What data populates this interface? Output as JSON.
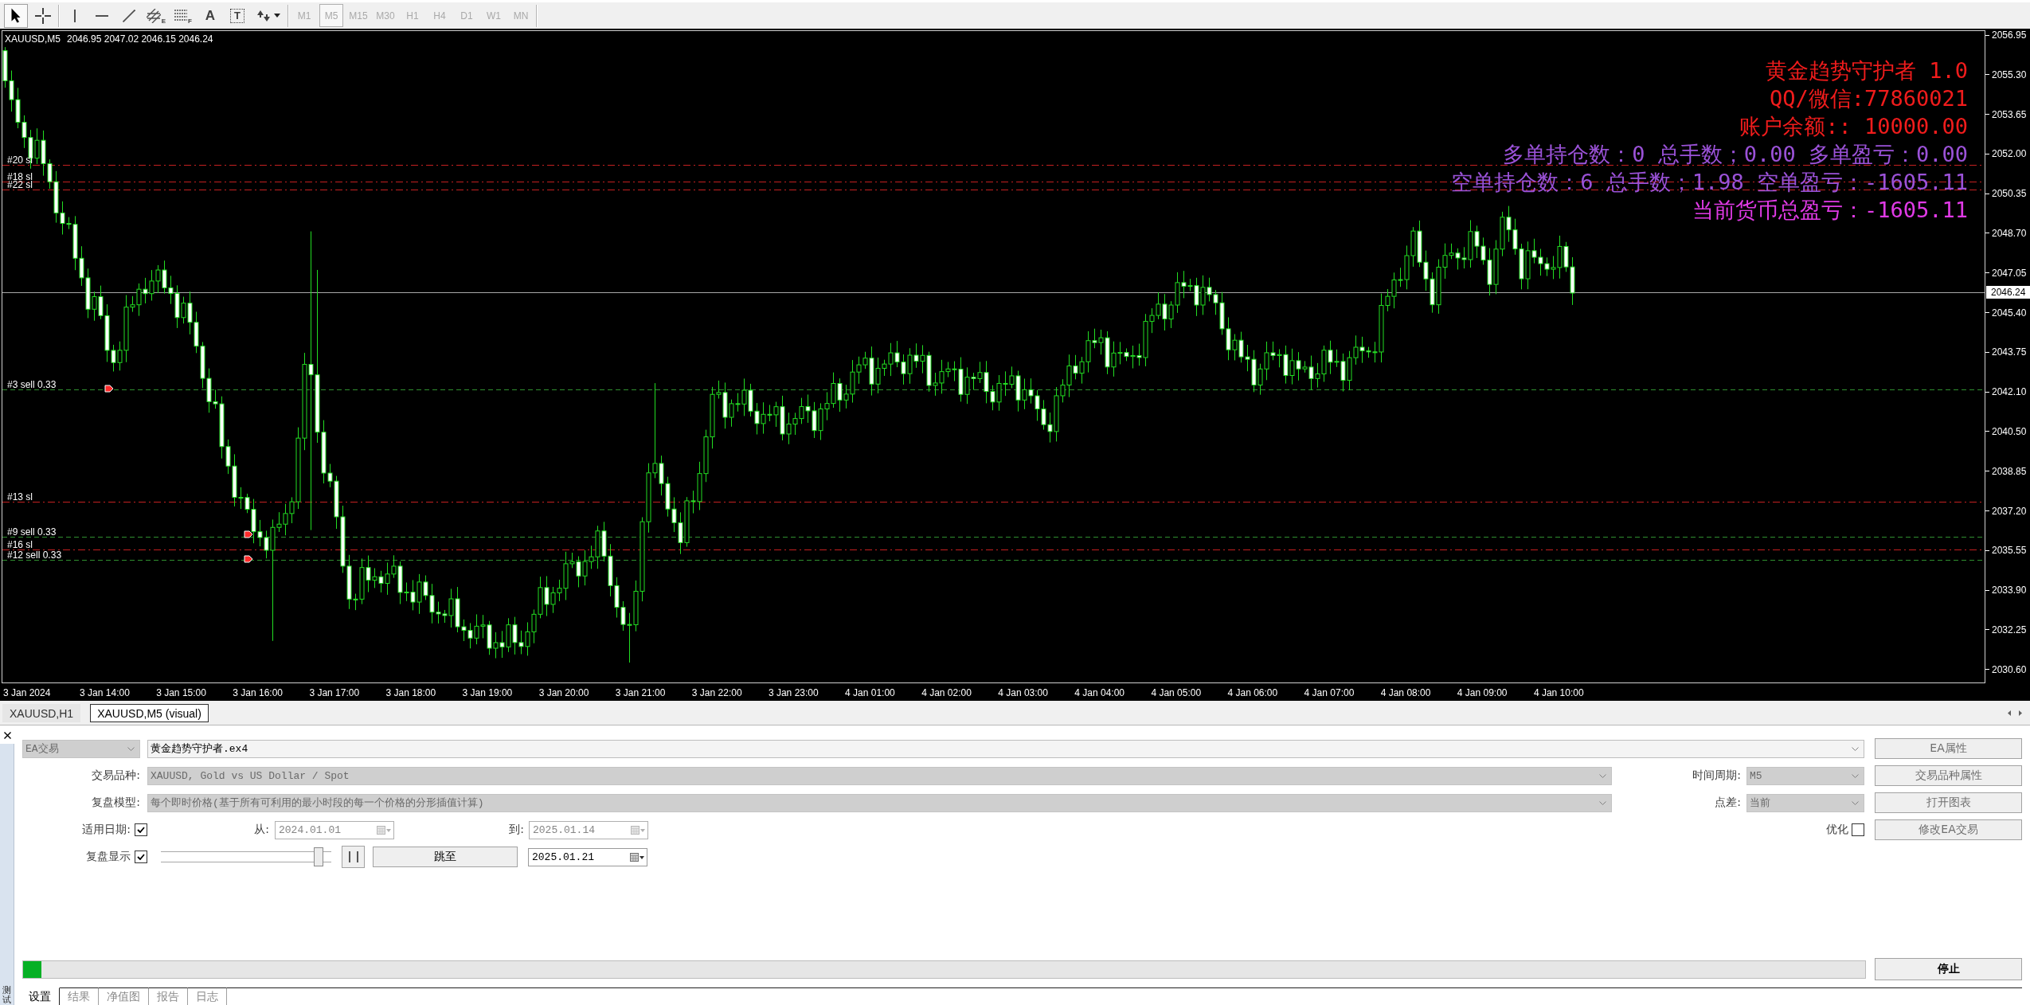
{
  "toolbar": {
    "tools": [
      {
        "kind": "cursor",
        "selected": true
      },
      {
        "kind": "crosshair",
        "selected": false
      },
      {
        "kind": "vertical_line",
        "selected": false
      },
      {
        "kind": "horizontal_line",
        "selected": false
      },
      {
        "kind": "trend_line",
        "selected": false
      },
      {
        "kind": "fibo_channel",
        "glyph": "E",
        "selected": false
      },
      {
        "kind": "fibo_levels",
        "glyph": "F",
        "selected": false
      },
      {
        "kind": "text",
        "glyph": "A",
        "selected": false
      },
      {
        "kind": "label",
        "glyph": "T",
        "selected": false
      },
      {
        "kind": "arrows",
        "selected": false
      }
    ],
    "timeframes": [
      {
        "label": "M1",
        "selected": false,
        "disabled": true
      },
      {
        "label": "M5",
        "selected": true,
        "disabled": true
      },
      {
        "label": "M15",
        "selected": false,
        "disabled": true
      },
      {
        "label": "M30",
        "selected": false,
        "disabled": true
      },
      {
        "label": "H1",
        "selected": false,
        "disabled": true
      },
      {
        "label": "H4",
        "selected": false,
        "disabled": true
      },
      {
        "label": "D1",
        "selected": false,
        "disabled": true
      },
      {
        "label": "W1",
        "selected": false,
        "disabled": true
      },
      {
        "label": "MN",
        "selected": false,
        "disabled": true
      }
    ]
  },
  "chart": {
    "symbol": "XAUUSD,M5",
    "ohlc": "2046.95 2047.02 2046.15 2046.24",
    "info_lines": [
      {
        "text": "黄金趋势守护者 1.0",
        "color": "#f01c1c"
      },
      {
        "text": "QQ/微信:77860021",
        "color": "#f01c1c"
      },
      {
        "text": "账户余额:: 10000.00",
        "color": "#f01c1c"
      },
      {
        "text": "多单持仓数：0 总手数；0.00 多单盈亏：0.00",
        "color": "#9b52d8"
      },
      {
        "text": "空单持仓数：6 总手数；1.98 空单盈亏：-1605.11",
        "color": "#9b52d8"
      },
      {
        "text": "当前货币总盈亏：-1605.11",
        "color": "#e03ae6"
      }
    ],
    "order_lines": [
      {
        "label": "#20 sl",
        "kind": "stop_loss"
      },
      {
        "label": "#18 sl",
        "kind": "stop_loss"
      },
      {
        "label": "#22 sl",
        "kind": "stop_loss"
      },
      {
        "label": "#3 sell 0.33",
        "kind": "order"
      },
      {
        "label": "#13 sl",
        "kind": "stop_loss"
      },
      {
        "label": "#9 sell 0.33",
        "kind": "order"
      },
      {
        "label": "#16 sl",
        "kind": "stop_loss"
      },
      {
        "label": "#12 sell 0.33",
        "kind": "order"
      }
    ],
    "price_labels": [
      "2056.95",
      "2055.30",
      "2053.65",
      "2052.00",
      "2050.35",
      "2048.70",
      "2047.05",
      "2045.40",
      "2043.75",
      "2042.10",
      "2040.50",
      "2038.85",
      "2037.20",
      "2035.55",
      "2033.90",
      "2032.25",
      "2030.60"
    ],
    "current_price": "2046.24",
    "time_labels": [
      "3 Jan 2024",
      "3 Jan 14:00",
      "3 Jan 15:00",
      "3 Jan 16:00",
      "3 Jan 17:00",
      "3 Jan 18:00",
      "3 Jan 19:00",
      "3 Jan 20:00",
      "3 Jan 21:00",
      "3 Jan 22:00",
      "3 Jan 23:00",
      "4 Jan 01:00",
      "4 Jan 02:00",
      "4 Jan 03:00",
      "4 Jan 04:00",
      "4 Jan 05:00",
      "4 Jan 06:00",
      "4 Jan 07:00",
      "4 Jan 08:00",
      "4 Jan 09:00",
      "4 Jan 10:00"
    ]
  },
  "chart_tabs": [
    {
      "label": "XAUUSD,H1",
      "selected": false
    },
    {
      "label": "XAUUSD,M5 (visual)",
      "selected": true
    }
  ],
  "tester": {
    "side_title": "测试",
    "expert_type": {
      "value": "EA交易",
      "disabled": true
    },
    "expert": {
      "value": "黄金趋势守护者.ex4",
      "disabled": false
    },
    "symbol": {
      "label": "交易品种:",
      "value": "XAUUSD, Gold vs US Dollar / Spot",
      "disabled": true
    },
    "period": {
      "label": "时间周期:",
      "value": "M5",
      "disabled": true
    },
    "model": {
      "label": "复盘模型:",
      "value": "每个即时价格(基于所有可利用的最小时段的每一个价格的分形插值计算)",
      "disabled": true
    },
    "spread": {
      "label": "点差:",
      "value": "当前",
      "disabled": true
    },
    "use_date": {
      "label": "适用日期:",
      "checked": true
    },
    "date_from": {
      "label": "从:",
      "value": "2024.01.01",
      "disabled": true
    },
    "date_to": {
      "label": "到:",
      "value": "2025.01.14",
      "disabled": true
    },
    "optimization": {
      "label": "优化",
      "checked": false
    },
    "visual_mode": {
      "label": "复盘显示",
      "checked": true
    },
    "speed": {
      "level": 0.95
    },
    "skip_button": "跳至",
    "skip_date": {
      "value": "2025.01.21",
      "disabled": false
    },
    "side_buttons": [
      {
        "label": "EA属性",
        "disabled": true
      },
      {
        "label": "交易品种属性",
        "disabled": true
      },
      {
        "label": "打开图表",
        "disabled": true
      },
      {
        "label": "修改EA交易",
        "disabled": true
      }
    ],
    "progress": {
      "level": 0.01
    },
    "stop_button": "停止"
  },
  "bottom_tabs": [
    {
      "label": "设置",
      "selected": true
    },
    {
      "label": "结果",
      "selected": false
    },
    {
      "label": "净值图",
      "selected": false
    },
    {
      "label": "报告",
      "selected": false
    },
    {
      "label": "日志",
      "selected": false
    }
  ]
}
